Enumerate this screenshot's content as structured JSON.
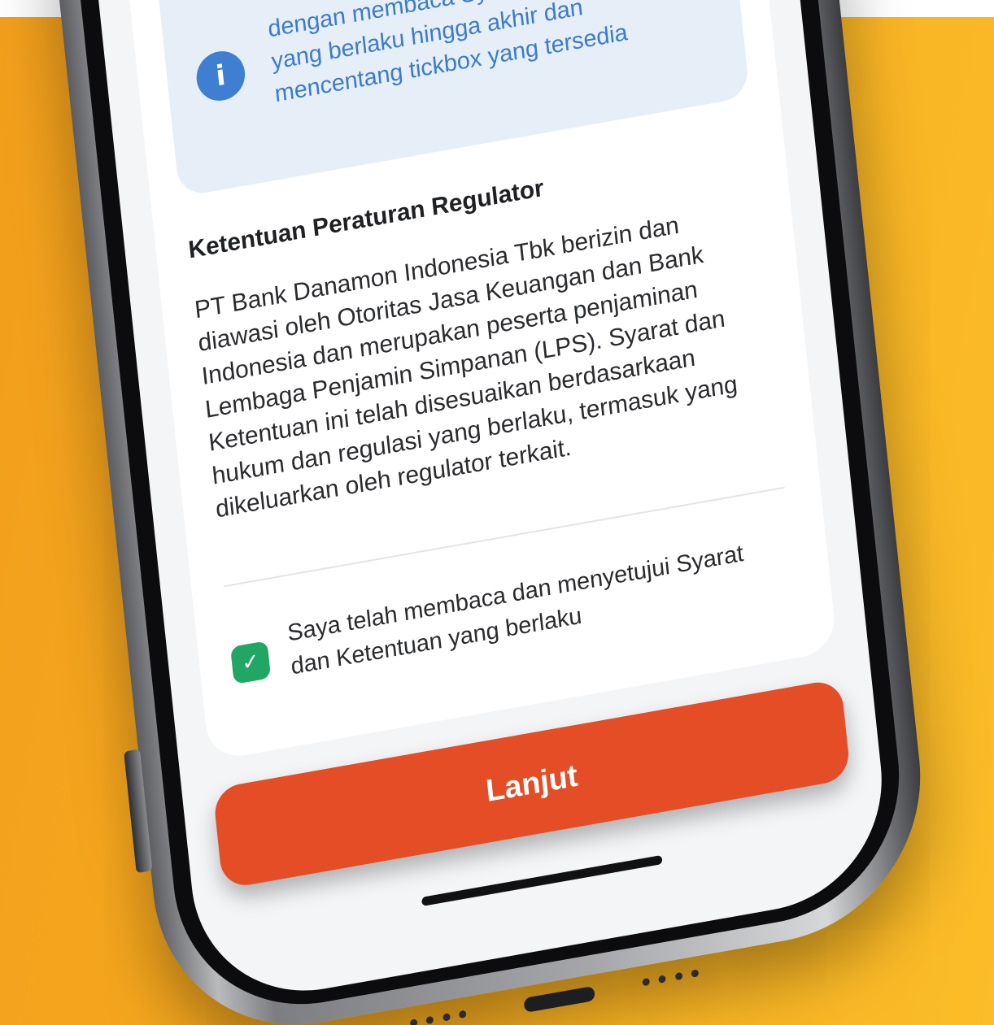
{
  "colors": {
    "background": "#f6ac1f",
    "info_blue": "#3d7bc9",
    "checkbox_green": "#21a663",
    "button_red": "#e44d25"
  },
  "info": {
    "icon": "info-icon",
    "icon_glyph": "i",
    "text": "dengan membaca Syarat & Ketentuan yang berlaku hingga akhir dan mencentang tickbox yang tersedia"
  },
  "regulator": {
    "title": "Ketentuan Peraturan Regulator",
    "body": "PT Bank Danamon Indonesia Tbk berizin dan diawasi oleh Otoritas Jasa Keuangan dan Bank Indonesia dan merupakan peserta penjaminan Lembaga Penjamin Simpanan (LPS). Syarat dan Ketentuan ini telah disesuaikan berdasarkaan hukum dan regulasi yang berlaku, termasuk yang dikeluarkan oleh regulator terkait."
  },
  "agreement": {
    "checked": true,
    "check_icon": "check-icon",
    "check_glyph": "✓",
    "label": "Saya telah membaca dan menyetujui Syarat dan Ketentuan yang berlaku"
  },
  "cta": {
    "label": "Lanjut"
  }
}
